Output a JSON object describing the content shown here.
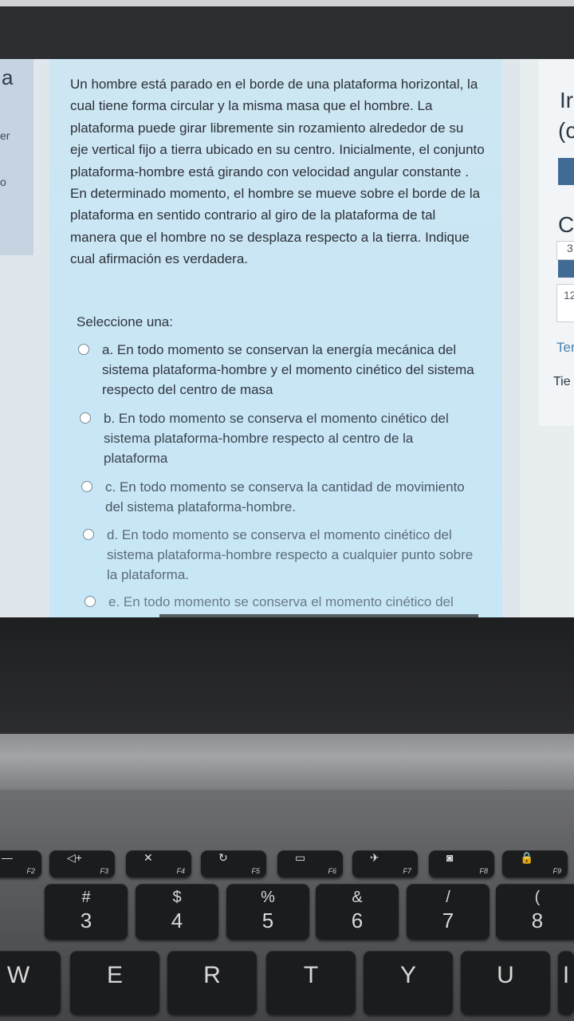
{
  "left_fragments": [
    "a",
    "er",
    "o"
  ],
  "question": "Un hombre está parado en el borde de una plataforma horizontal, la cual tiene forma circular y la misma masa que el hombre. La plataforma puede girar libremente sin rozamiento alrededor de su eje vertical fijo a tierra ubicado en su centro. Inicialmente, el conjunto plataforma-hombre está girando con velocidad angular constante . En determinado momento, el hombre se mueve sobre el borde de la plataforma en sentido contrario al giro de la plataforma de tal manera que el hombre no se desplaza respecto a la tierra. Indique cual afirmación es verdadera.",
  "select_label": "Seleccione una:",
  "options": [
    "a. En todo momento se conservan la energía mecánica del sistema plataforma-hombre y el momento cinético del sistema  respecto del centro de masa",
    "b. En todo momento se conserva el momento cinético del sistema plataforma-hombre respecto al centro de la plataforma",
    "c. En todo momento se conserva la cantidad de movimiento del sistema plataforma-hombre.",
    "d. En todo momento se conserva el momento cinético del sistema plataforma-hombre respecto a cualquier punto sobre la plataforma.",
    "e. En todo momento se conserva el momento cinético del"
  ],
  "right_fragments": {
    "i": "Ir",
    "paren": "(c",
    "c": "C",
    "three": "3",
    "twelve": "12",
    "ter": "Ter",
    "tie": "Tie"
  },
  "keyboard": {
    "fkeys": [
      {
        "fn": "F2",
        "icon": "—"
      },
      {
        "fn": "F3",
        "icon": "◁+"
      },
      {
        "fn": "F4",
        "icon": "✕"
      },
      {
        "fn": "F5",
        "icon": "↻"
      },
      {
        "fn": "F6",
        "icon": "▭"
      },
      {
        "fn": "F7",
        "icon": "✈"
      },
      {
        "fn": "F8",
        "icon": "◙"
      },
      {
        "fn": "F9",
        "icon": "🔒"
      }
    ],
    "numkeys": [
      {
        "sym": "#",
        "num": "3"
      },
      {
        "sym": "$",
        "num": "4"
      },
      {
        "sym": "%",
        "num": "5"
      },
      {
        "sym": "&",
        "num": "6"
      },
      {
        "sym": "/",
        "num": "7"
      },
      {
        "sym": "(",
        "num": "8"
      }
    ],
    "letters": [
      "W",
      "E",
      "R",
      "T",
      "Y",
      "U",
      "I"
    ]
  }
}
